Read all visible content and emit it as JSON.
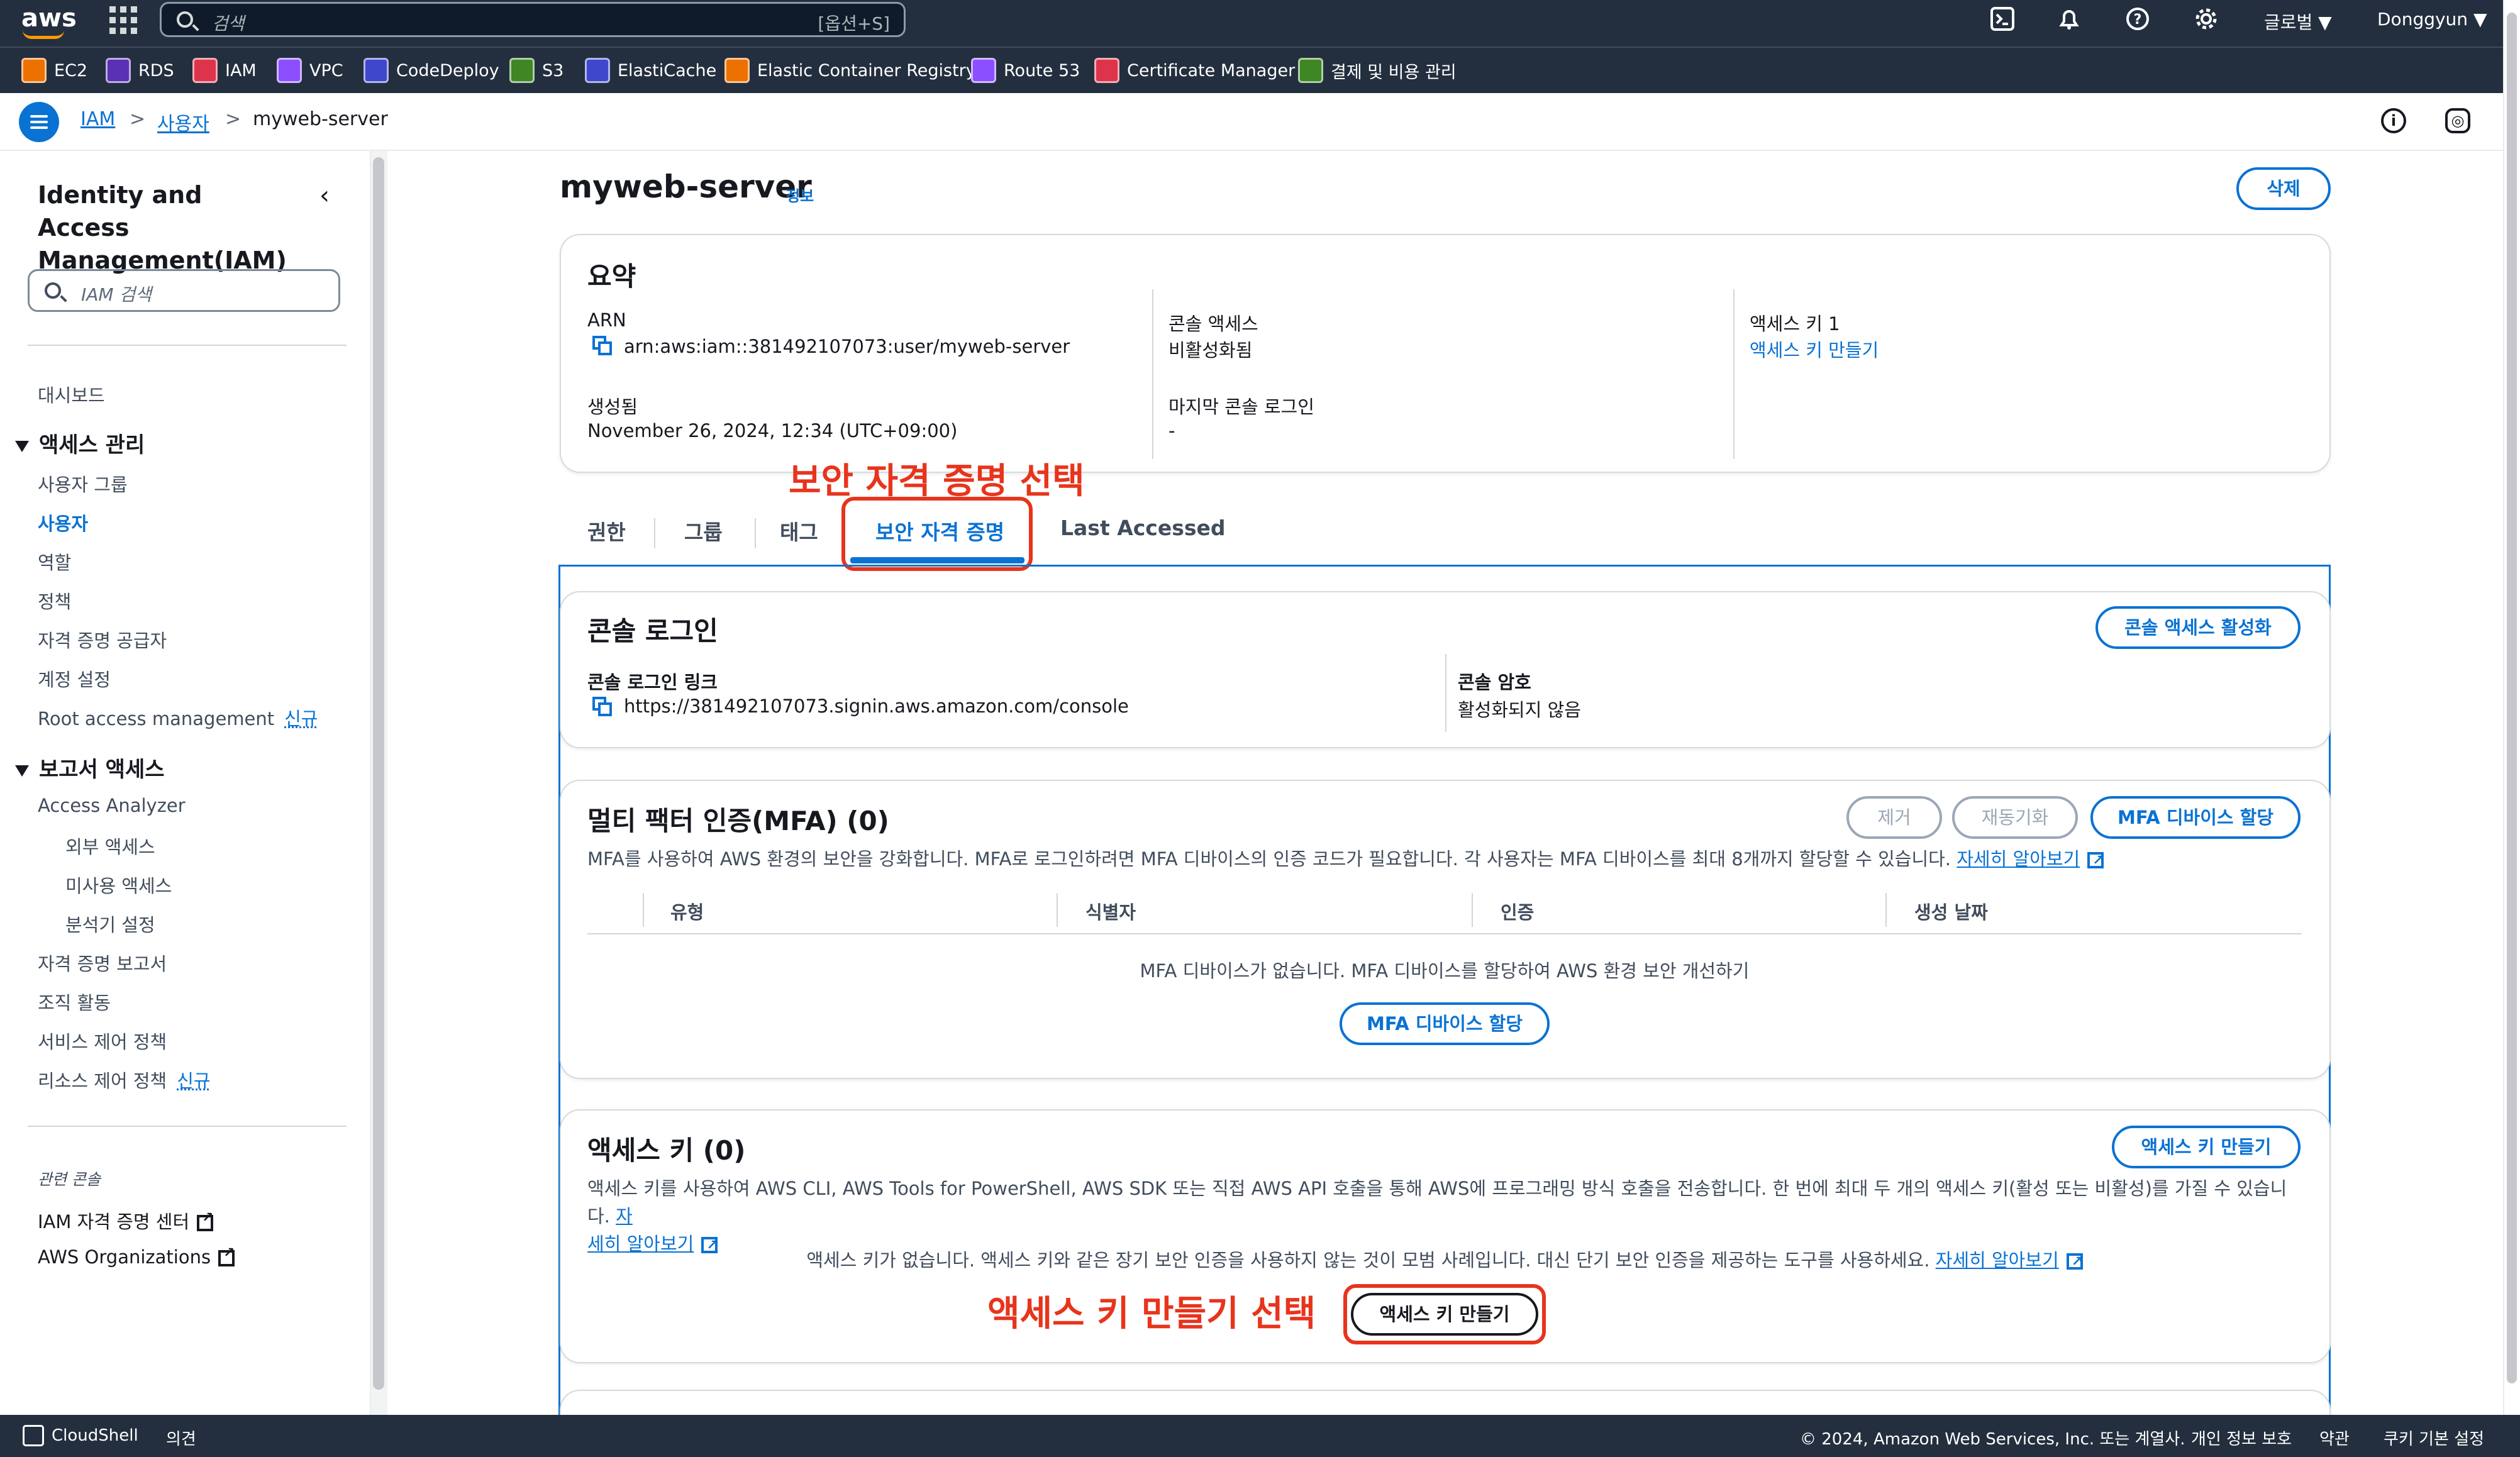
{
  "topnav": {
    "logo": "aws",
    "search_placeholder": "검색",
    "search_shortcut": "[옵션+S]",
    "region": "글로벌 ▼",
    "user": "Donggyun ▼",
    "icons": [
      "cloudshell-icon",
      "bell-icon",
      "help-icon",
      "gear-icon"
    ]
  },
  "favorites": [
    {
      "label": "EC2",
      "color": "#ed7100"
    },
    {
      "label": "RDS",
      "color": "#5a30b5"
    },
    {
      "label": "IAM",
      "color": "#dd344c"
    },
    {
      "label": "VPC",
      "color": "#8c4fff"
    },
    {
      "label": "CodeDeploy",
      "color": "#3f48cc"
    },
    {
      "label": "S3",
      "color": "#3f8624"
    },
    {
      "label": "ElastiCache",
      "color": "#3f48cc"
    },
    {
      "label": "Elastic Container Registry",
      "color": "#ed7100"
    },
    {
      "label": "Route 53",
      "color": "#8c4fff"
    },
    {
      "label": "Certificate Manager",
      "color": "#dd344c"
    },
    {
      "label": "결제 및 비용 관리",
      "color": "#3f8624"
    }
  ],
  "breadcrumb": {
    "items": [
      "IAM",
      "사용자",
      "myweb-server"
    ],
    "sep": ">"
  },
  "sidebar": {
    "title": "Identity and Access Management(IAM)",
    "collapse": "‹",
    "search_placeholder": "IAM 검색",
    "dashboard": "대시보드",
    "access_mgmt": {
      "heading": "액세스 관리",
      "items": [
        "사용자 그룹",
        "사용자",
        "역할",
        "정책",
        "자격 증명 공급자",
        "계정 설정",
        "Root access management"
      ]
    },
    "reports": {
      "heading": "보고서 액세스",
      "analyzer": "Access Analyzer",
      "analyzer_sub": [
        "외부 액세스",
        "미사용 액세스",
        "분석기 설정"
      ],
      "items": [
        "자격 증명 보고서",
        "조직 활동",
        "서비스 제어 정책",
        "리소스 제어 정책"
      ]
    },
    "new_badge": "신규",
    "related": {
      "heading": "관련 콘솔",
      "items": [
        "IAM 자격 증명 센터",
        "AWS Organizations"
      ]
    }
  },
  "main": {
    "title": "myweb-server",
    "info": "정보",
    "delete_btn": "삭제",
    "summary": {
      "heading": "요약",
      "arn_label": "ARN",
      "arn_value": "arn:aws:iam::381492107073:user/myweb-server",
      "created_label": "생성됨",
      "created_value": "November 26, 2024, 12:34 (UTC+09:00)",
      "console_access_label": "콘솔 액세스",
      "console_access_value": "비활성화됨",
      "last_login_label": "마지막 콘솔 로그인",
      "last_login_value": "-",
      "access_key_label": "액세스 키 1",
      "access_key_value": "액세스 키 만들기"
    },
    "tabs": [
      "권한",
      "그룹",
      "태그",
      "보안 자격 증명",
      "Last Accessed"
    ],
    "console_login": {
      "heading": "콘솔 로그인",
      "enable_btn": "콘솔 액세스 활성화",
      "link_label": "콘솔 로그인 링크",
      "link_value": "https://381492107073.signin.aws.amazon.com/console",
      "pw_label": "콘솔 암호",
      "pw_value": "활성화되지 않음"
    },
    "mfa": {
      "heading": "멀티 팩터 인증(MFA) (0)",
      "remove_btn": "제거",
      "resync_btn": "재동기화",
      "assign_btn": "MFA 디바이스 할당",
      "desc": "MFA를 사용하여 AWS 환경의 보안을 강화합니다. MFA로 로그인하려면 MFA 디바이스의 인증 코드가 필요합니다. 각 사용자는 MFA 디바이스를 최대 8개까지 할당할 수 있습니다.",
      "learn_more": "자세히 알아보기",
      "columns": [
        "유형",
        "식별자",
        "인증",
        "생성 날짜"
      ],
      "empty": "MFA 디바이스가 없습니다. MFA 디바이스를 할당하여 AWS 환경 보안 개선하기",
      "empty_btn": "MFA 디바이스 할당"
    },
    "access_keys": {
      "heading": "액세스 키 (0)",
      "create_btn": "액세스 키 만들기",
      "desc_line1": "액세스 키를 사용하여 AWS CLI, AWS Tools for PowerShell, AWS SDK 또는 직접 AWS API 호출을 통해 AWS에 프로그래밍 방식 호출을 전송합니다. 한 번에 최대 두 개의 액세스 키(활성 또는 비활성)를 가질 수 있습니다.",
      "desc_link_a": "자",
      "desc_link_b": "세히 알아보기",
      "empty": "액세스 키가 없습니다. 액세스 키와 같은 장기 보안 인증을 사용하지 않는 것이 모범 사례입니다. 대신 단기 보안 인증을 제공하는 도구를 사용하세요.",
      "empty_link": "자세히 알아보기",
      "empty_btn": "액세스 키 만들기"
    }
  },
  "annotations": {
    "tab_note": "보안 자격 증명 선택",
    "key_note": "액세스 키 만들기 선택",
    "color": "#e8341c"
  },
  "footer": {
    "cloudshell": "CloudShell",
    "feedback": "의견",
    "copyright": "© 2024, Amazon Web Services, Inc. 또는 계열사.",
    "privacy": "개인 정보 보호",
    "terms": "약관",
    "cookies": "쿠키 기본 설정"
  }
}
